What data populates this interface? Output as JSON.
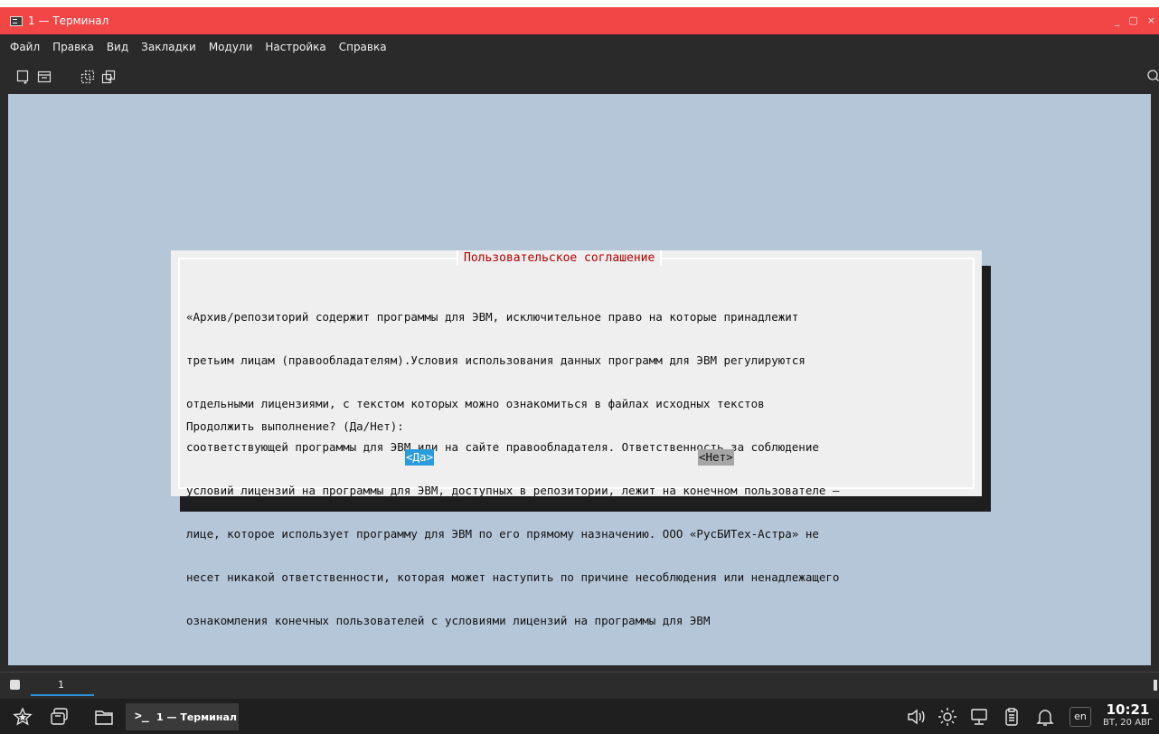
{
  "window": {
    "title": "1 — Терминал",
    "controls": [
      "_",
      "▢",
      "×"
    ]
  },
  "menu": [
    "Файл",
    "Правка",
    "Вид",
    "Закладки",
    "Модули",
    "Настройка",
    "Справка"
  ],
  "toolbar_icons": [
    "new-tab-icon",
    "split-view-icon",
    "detach-icon",
    "copy-icon",
    "search-icon"
  ],
  "dialog": {
    "title": "Пользовательское соглашение",
    "lines": [
      "«Архив/репозиторий содержит программы для ЭВМ, исключительное право на которые принадлежит",
      "третьим лицам (правообладателям).Условия использования данных программ для ЭВМ регулируются",
      "отдельными лицензиями, с текстом которых можно ознакомиться в файлах исходных текстов",
      "соответствующей программы для ЭВМ или на сайте правообладателя. Ответственность за соблюдение",
      "условий лицензий на программы для ЭВМ, доступных в репозитории, лежит на конечном пользователе –",
      "лице, которое использует программу для ЭВМ по его прямому назначению. ООО «РусБИТех-Астра» не",
      "несет никакой ответственности, которая может наступить по причине несоблюдения или ненадлежащего",
      "ознакомления конечных пользователей с условиями лицензий на программы для ЭВМ"
    ],
    "prompt": "Продолжить выполнение? (Да/Нет):",
    "yes_label": "<Да>",
    "no_label": "<Нет>"
  },
  "tabs": [
    {
      "label": "1"
    }
  ],
  "taskbar": {
    "window_title": "1 — Терминал",
    "lang": "en",
    "time": "10:21",
    "date": "ВТ, 20 АВГ"
  },
  "colors": {
    "titlebar": "#f24545",
    "terminal_bg": "#b6c6d9",
    "dialog_title": "#b40000",
    "yes_button": "#2a9bdb",
    "no_button": "#a6a6a6"
  }
}
